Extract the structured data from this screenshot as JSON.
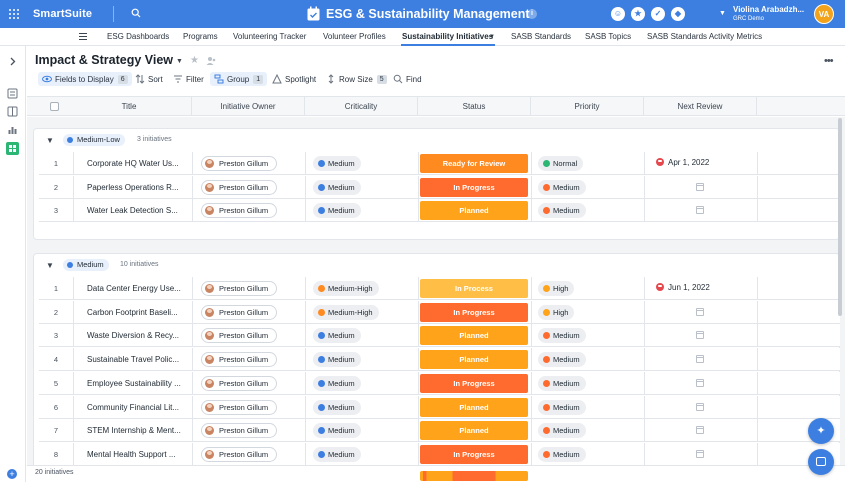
{
  "app": {
    "brand": "SmartSuite",
    "workspace_title": "ESG & Sustainability Management",
    "info": "i",
    "user": {
      "name": "Violina Arabadzh...",
      "org": "GRC Demo",
      "initials": "VA"
    }
  },
  "tabs": [
    {
      "label": "ESG Dashboards"
    },
    {
      "label": "Programs"
    },
    {
      "label": "Volunteering Tracker"
    },
    {
      "label": "Volunteer Profiles"
    },
    {
      "label": "Sustainability Initiatives",
      "active": true
    },
    {
      "label": "SASB Standards"
    },
    {
      "label": "SASB Topics"
    },
    {
      "label": "SASB Standards Activity Metrics"
    }
  ],
  "view": {
    "title": "Impact & Strategy View",
    "toolbar": {
      "fields": "Fields to Display",
      "fields_count": "6",
      "sort": "Sort",
      "filter": "Filter",
      "group": "Group",
      "group_count": "1",
      "spotlight": "Spotlight",
      "row_size": "Row Size",
      "row_size_count": "5",
      "find": "Find"
    }
  },
  "columns": [
    "Title",
    "Initiative Owner",
    "Criticality",
    "Status",
    "Priority",
    "Next Review"
  ],
  "colors": {
    "accent": "#3d7fe0",
    "criticality": {
      "Medium": "#3d7fe0",
      "Medium-High": "#ff8a1f"
    },
    "priority": {
      "Normal": "#2bb673",
      "High": "#ffa31a",
      "Medium": "#ff6b2e"
    },
    "status": {
      "Ready for Review": "#ff8a1f",
      "In Progress": "#ff6b2e",
      "Planned": "#ffa31a",
      "In Process": "#ffbf47"
    }
  },
  "groups": [
    {
      "label": "Medium-Low",
      "count": "3 initiatives",
      "rows": [
        {
          "num": "1",
          "title": "Corporate HQ Water Us...",
          "owner": "Preston Gillum",
          "criticality": "Medium",
          "status": "Ready for Review",
          "priority": "Normal",
          "review": "Apr 1, 2022"
        },
        {
          "num": "2",
          "title": "Paperless Operations R...",
          "owner": "Preston Gillum",
          "criticality": "Medium",
          "status": "In Progress",
          "priority": "Medium",
          "review": ""
        },
        {
          "num": "3",
          "title": "Water Leak Detection S...",
          "owner": "Preston Gillum",
          "criticality": "Medium",
          "status": "Planned",
          "priority": "Medium",
          "review": ""
        }
      ]
    },
    {
      "label": "Medium",
      "count": "10 initiatives",
      "rows": [
        {
          "num": "1",
          "title": "Data Center Energy Use...",
          "owner": "Preston Gillum",
          "criticality": "Medium-High",
          "status": "In Process",
          "priority": "High",
          "review": "Jun 1, 2022"
        },
        {
          "num": "2",
          "title": "Carbon Footprint Baseli...",
          "owner": "Preston Gillum",
          "criticality": "Medium-High",
          "status": "In Progress",
          "priority": "High",
          "review": ""
        },
        {
          "num": "3",
          "title": "Waste Diversion & Recy...",
          "owner": "Preston Gillum",
          "criticality": "Medium",
          "status": "Planned",
          "priority": "Medium",
          "review": ""
        },
        {
          "num": "4",
          "title": "Sustainable Travel Polic...",
          "owner": "Preston Gillum",
          "criticality": "Medium",
          "status": "Planned",
          "priority": "Medium",
          "review": ""
        },
        {
          "num": "5",
          "title": "Employee Sustainability ...",
          "owner": "Preston Gillum",
          "criticality": "Medium",
          "status": "In Progress",
          "priority": "Medium",
          "review": ""
        },
        {
          "num": "6",
          "title": "Community Financial Lit...",
          "owner": "Preston Gillum",
          "criticality": "Medium",
          "status": "Planned",
          "priority": "Medium",
          "review": ""
        },
        {
          "num": "7",
          "title": "STEM Internship & Ment...",
          "owner": "Preston Gillum",
          "criticality": "Medium",
          "status": "Planned",
          "priority": "Medium",
          "review": ""
        },
        {
          "num": "8",
          "title": "Mental Health Support ...",
          "owner": "Preston Gillum",
          "criticality": "Medium",
          "status": "In Progress",
          "priority": "Medium",
          "review": ""
        }
      ]
    }
  ],
  "footer": {
    "count": "20 initiatives"
  }
}
